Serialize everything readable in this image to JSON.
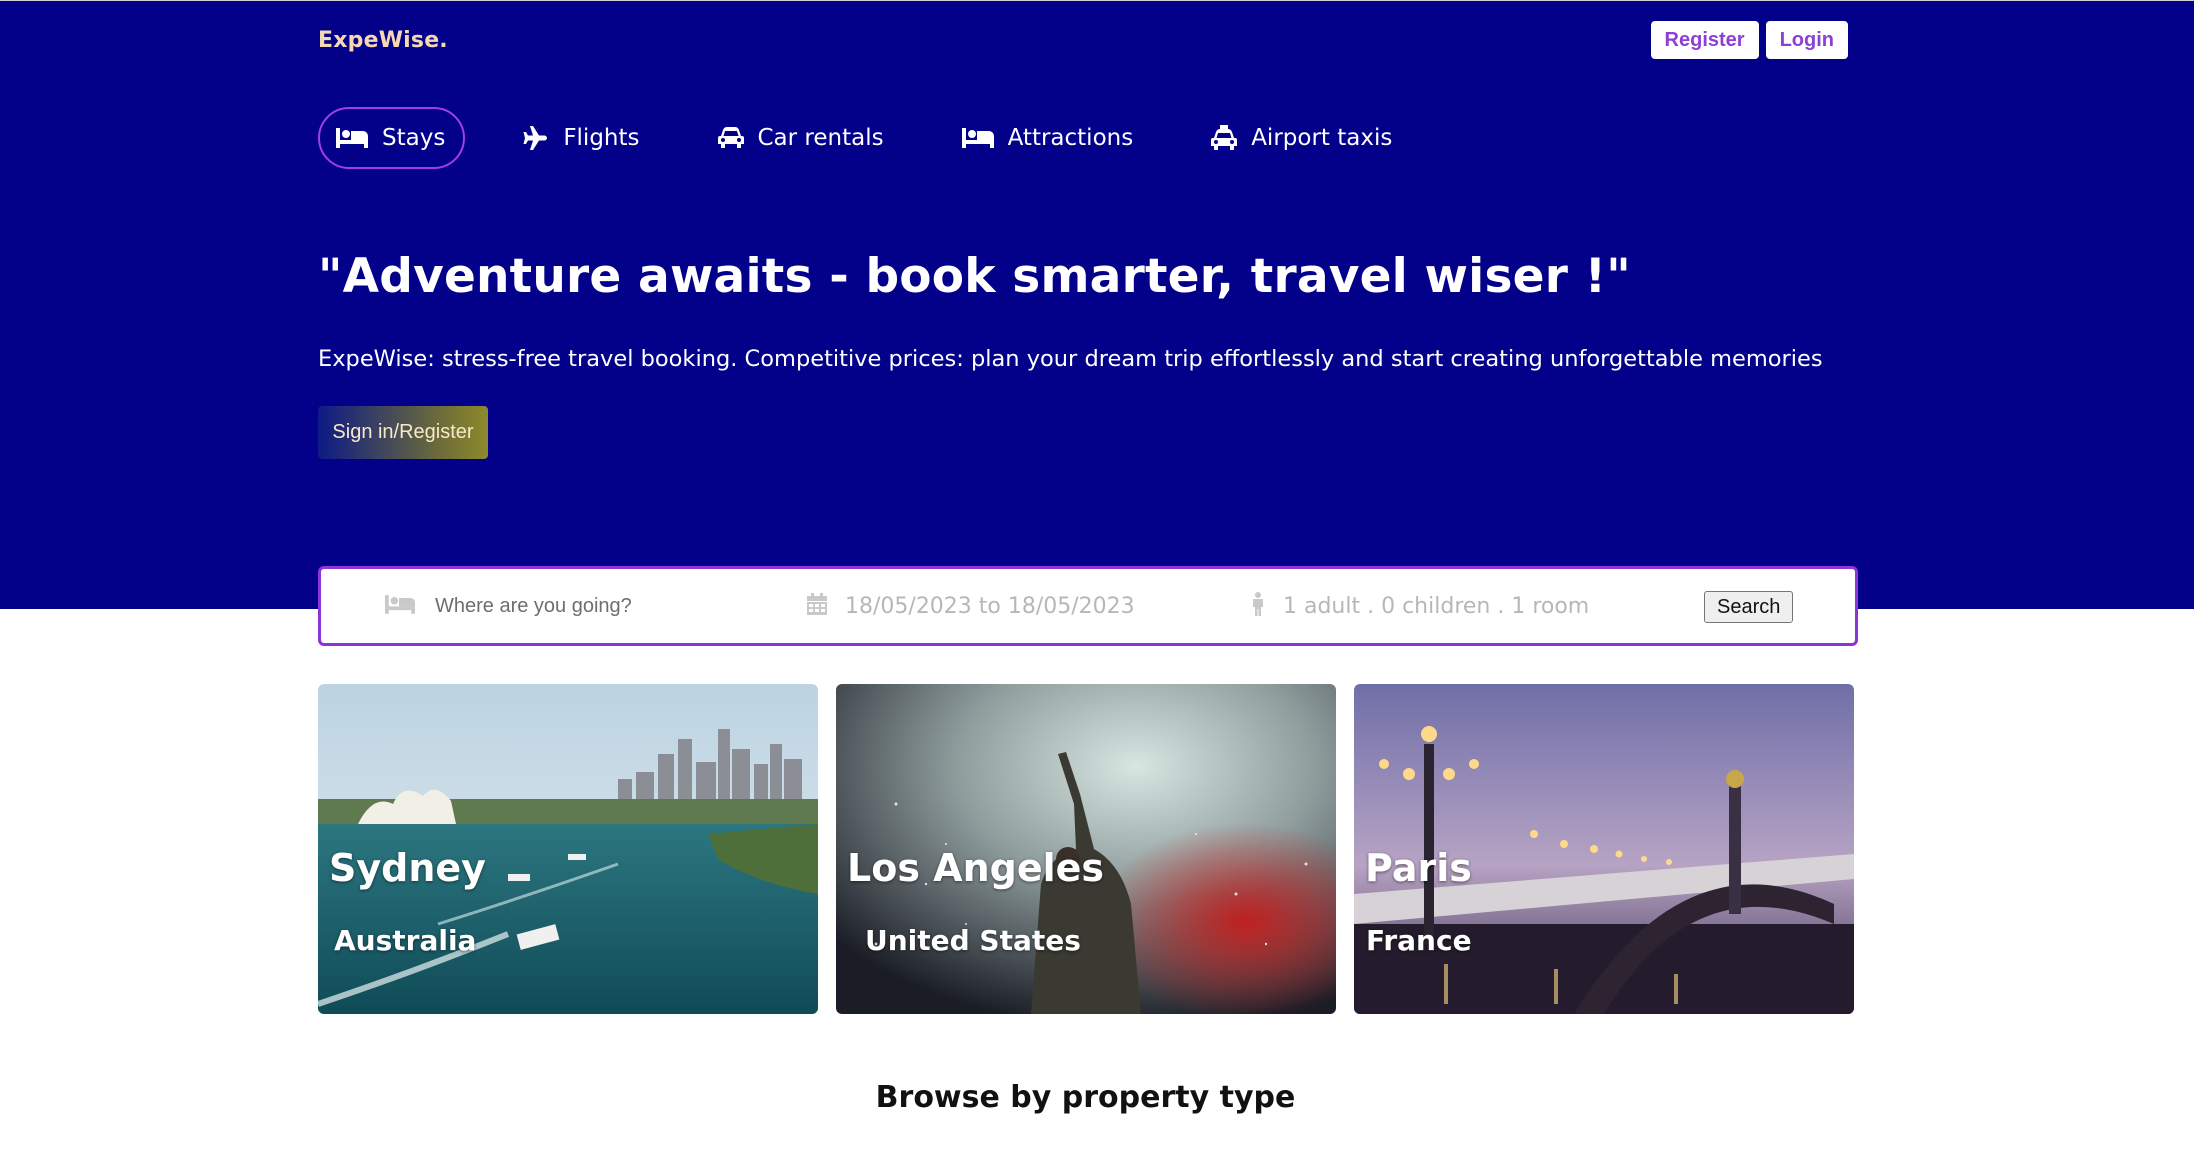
{
  "brand": {
    "name": "ExpeWise.",
    "colors": {
      "header_bg": "#03008a",
      "accent": "#8e34d6",
      "logo": "#f6d9b0"
    }
  },
  "auth": {
    "register_label": "Register",
    "login_label": "Login"
  },
  "nav": {
    "items": [
      {
        "label": "Stays",
        "icon": "bed-icon",
        "active": true
      },
      {
        "label": "Flights",
        "icon": "plane-icon",
        "active": false
      },
      {
        "label": "Car rentals",
        "icon": "car-icon",
        "active": false
      },
      {
        "label": "Attractions",
        "icon": "bed-icon",
        "active": false
      },
      {
        "label": "Airport taxis",
        "icon": "taxi-icon",
        "active": false
      }
    ]
  },
  "hero": {
    "title": "\"Adventure awaits - book smarter, travel wiser !\"",
    "description": "ExpeWise: stress-free travel booking. Competitive prices: plan your dream trip effortlessly and start creating unforgettable memories",
    "cta_label": "Sign in/Register"
  },
  "search": {
    "destination_placeholder": "Where are you going?",
    "destination_value": "",
    "dates": "18/05/2023 to 18/05/2023",
    "guests": "1 adult . 0 children . 1 room",
    "button_label": "Search",
    "icons": [
      "bed-icon",
      "calendar-icon",
      "person-icon"
    ]
  },
  "featured": [
    {
      "city": "Sydney",
      "country": "Australia"
    },
    {
      "city": "Los Angeles",
      "country": "United States"
    },
    {
      "city": "Paris",
      "country": "France"
    }
  ],
  "sections": {
    "property_type_title": "Browse by property type"
  }
}
